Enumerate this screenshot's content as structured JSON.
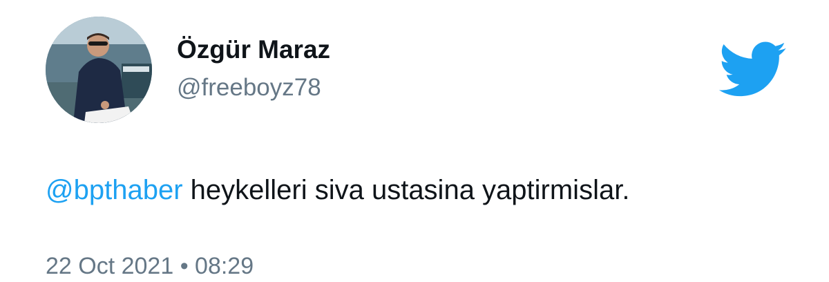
{
  "user": {
    "display_name": "Özgür Maraz",
    "handle": "@freeboyz78"
  },
  "logo": {
    "icon": "twitter-bird-icon",
    "color": "#1da1f2"
  },
  "tweet": {
    "mention": "@bpthaber",
    "body": " heykelleri siva ustasina yaptirmislar."
  },
  "meta": {
    "date": "22 Oct 2021",
    "separator": " • ",
    "time": "08:29"
  },
  "colors": {
    "mention": "#1da1f2",
    "secondary_text": "#657786",
    "primary_text": "#0f1419"
  }
}
